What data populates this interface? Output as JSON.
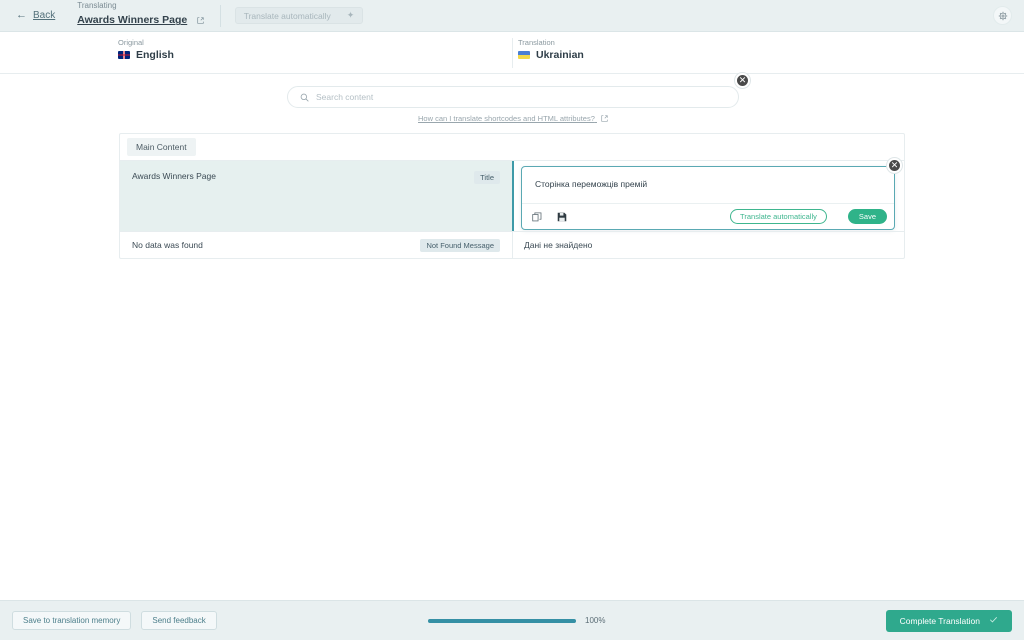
{
  "topbar": {
    "back_label": "Back",
    "translating_label": "Translating",
    "page_title": "Awards Winners Page",
    "translate_auto_label": "Translate automatically",
    "settings_icon": "gear-icon",
    "external_link_icon": "external-link-icon"
  },
  "languages": {
    "original_label": "Original",
    "original_name": "English",
    "translation_label": "Translation",
    "translation_name": "Ukrainian"
  },
  "search": {
    "placeholder": "Search content",
    "value": "",
    "icon": "search-icon",
    "close_icon": "close-icon",
    "help_text": "How can I translate shortcodes and HTML attributes?"
  },
  "panel": {
    "tab_label": "Main Content",
    "rows": [
      {
        "source": "Awards Winners Page",
        "badge": "Title",
        "translation": "Сторінка переможців премій",
        "active": true
      },
      {
        "source": "No data was found",
        "badge": "Not Found Message",
        "translation": "Дані не знайдено",
        "active": false
      }
    ]
  },
  "editor": {
    "value": "Сторінка переможців премій",
    "copy_icon": "copy-icon",
    "save_icon": "floppy-disk-icon",
    "translate_auto_label": "Translate automatically",
    "save_label": "Save",
    "close_icon": "close-icon"
  },
  "bottombar": {
    "save_memory_label": "Save to translation memory",
    "feedback_label": "Send feedback",
    "progress_percent": "100%",
    "progress_value": 100,
    "complete_label": "Complete Translation",
    "check_icon": "check-icon"
  },
  "colors": {
    "accent_teal": "#3590a5",
    "accent_green": "#2fb389",
    "header_bg": "#e9f0f1",
    "active_row": "#e6f0ef"
  }
}
